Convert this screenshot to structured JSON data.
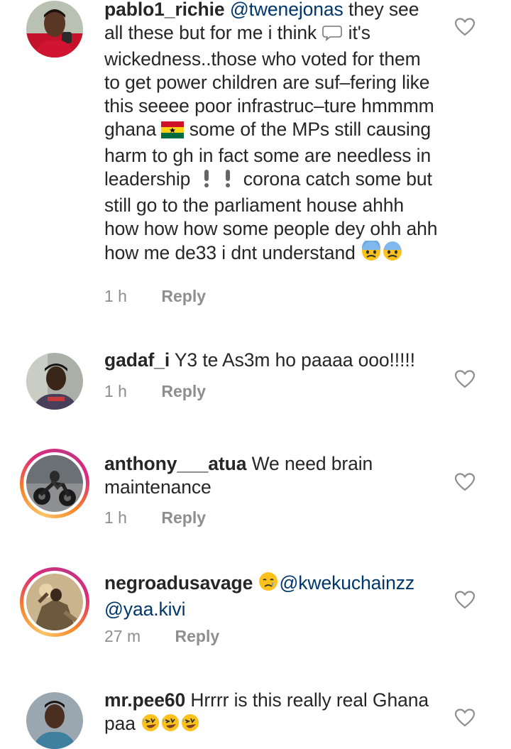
{
  "comments": [
    {
      "username": "pablo1_richie",
      "text_parts": [
        {
          "kind": "mention",
          "text": "@twenejonas"
        },
        {
          "kind": "text",
          "text": " they see all these but for me i think "
        },
        {
          "kind": "emoji",
          "icon": "thought-balloon-icon"
        },
        {
          "kind": "text",
          "text": " it's wickedness..those who voted for them to get power children are suf–fering like this seeee poor infrastruc–ture hmmmm ghana "
        },
        {
          "kind": "emoji",
          "icon": "ghana-flag-icon"
        },
        {
          "kind": "text",
          "text": " some of the MPs still causing harm to gh in fact some are needless in leadership "
        },
        {
          "kind": "emoji",
          "icon": "exclamation-icon"
        },
        {
          "kind": "emoji",
          "icon": "exclamation-icon"
        },
        {
          "kind": "text",
          "text": " corona catch some but still go to the parliament house ahhh how how how some people dey ohh ahh how me de33 i dnt understand "
        },
        {
          "kind": "emoji",
          "icon": "fearful-face-icon"
        },
        {
          "kind": "emoji",
          "icon": "fearful-face-icon"
        }
      ],
      "time": "1 h",
      "reply": "Reply"
    },
    {
      "username": "gadaf_i",
      "text_parts": [
        {
          "kind": "text",
          "text": " Y3 te As3m ho paaaa ooo!!!!!"
        }
      ],
      "time": "1 h",
      "reply": "Reply"
    },
    {
      "username": "anthony___atua",
      "text_parts": [
        {
          "kind": "text",
          "text": " We need brain maintenance"
        }
      ],
      "time": "1 h",
      "reply": "Reply"
    },
    {
      "username": "negroadusavage",
      "text_parts": [
        {
          "kind": "emoji",
          "icon": "crying-face-icon"
        },
        {
          "kind": "mention",
          "text": "@kwekuchainzz"
        },
        {
          "kind": "text",
          "text": " "
        },
        {
          "kind": "mention",
          "text": "@yaa.kivi"
        }
      ],
      "time": "27 m",
      "reply": "Reply"
    },
    {
      "username": "mr.pee60",
      "text_parts": [
        {
          "kind": "text",
          "text": " Hrrrr is this really real Ghana paa "
        },
        {
          "kind": "emoji",
          "icon": "rofl-face-icon"
        },
        {
          "kind": "emoji",
          "icon": "rofl-face-icon"
        },
        {
          "kind": "emoji",
          "icon": "rofl-face-icon"
        }
      ],
      "time": "",
      "reply": ""
    }
  ],
  "colors": {
    "text": "#262626",
    "mention": "#00376b",
    "meta": "#8e8e8e",
    "heart_outline": "#8e8e8e"
  }
}
